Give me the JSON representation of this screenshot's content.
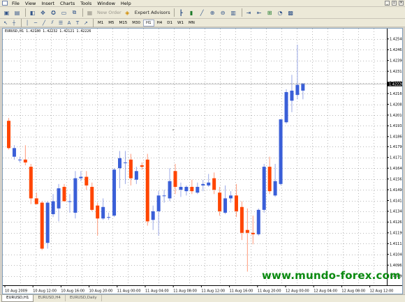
{
  "menu": [
    "File",
    "View",
    "Insert",
    "Charts",
    "Tools",
    "Window",
    "Help"
  ],
  "toolbar": {
    "new_order_label": "New Order",
    "expert_advisors_label": "Expert Advisors",
    "timeframes": [
      "M1",
      "M5",
      "M15",
      "M30",
      "H1",
      "H4",
      "D1",
      "W1",
      "MN"
    ],
    "active_timeframe": "H1"
  },
  "chart": {
    "title": "EURUSD,H1  1.42180 1.42232 1.42121 1.42226",
    "current_price": "1.42226",
    "bull_color": "#3a5fd8",
    "bear_color": "#ff4500",
    "watermark": "www.mundo-forex.com"
  },
  "chart_data": {
    "type": "candlestick",
    "title": "EURUSD,H1  1.42180 1.42232 1.42121 1.42226",
    "symbol": "EURUSD",
    "timeframe": "H1",
    "ohlc": [
      1.4218,
      1.42232,
      1.42121,
      1.42226
    ],
    "ylim": [
      1.40825,
      1.42612
    ],
    "y_ticks": [
      "1.42540",
      "1.42465",
      "1.42390",
      "1.42315",
      "1.42235",
      "1.42160",
      "1.42085",
      "1.42010",
      "1.41935",
      "1.41860",
      "1.41790",
      "1.41715",
      "1.41640",
      "1.41565",
      "1.41490",
      "1.41415",
      "1.41340",
      "1.41265",
      "1.41190",
      "1.41115",
      "1.41040",
      "1.40965",
      "1.40890"
    ],
    "x_ticks": [
      "10 Aug 2009",
      "10 Aug 12:00",
      "10 Aug 16:00",
      "10 Aug 20:00",
      "11 Aug 00:00",
      "11 Aug 04:00",
      "11 Aug 08:00",
      "11 Aug 12:00",
      "11 Aug 16:00",
      "11 Aug 20:00",
      "12 Aug 00:00",
      "12 Aug 04:00",
      "12 Aug 08:00",
      "12 Aug 12:00"
    ],
    "candles": [
      {
        "o": 1.4197,
        "h": 1.4199,
        "l": 1.4177,
        "c": 1.4178
      },
      {
        "o": 1.4172,
        "h": 1.418,
        "l": 1.417,
        "c": 1.4178
      },
      {
        "o": 1.417,
        "h": 1.4172,
        "l": 1.4168,
        "c": 1.417
      },
      {
        "o": 1.417,
        "h": 1.418,
        "l": 1.4166,
        "c": 1.4168
      },
      {
        "o": 1.4165,
        "h": 1.4167,
        "l": 1.4139,
        "c": 1.4143
      },
      {
        "o": 1.4143,
        "h": 1.4147,
        "l": 1.4139,
        "c": 1.4139
      },
      {
        "o": 1.414,
        "h": 1.4141,
        "l": 1.4107,
        "c": 1.4108
      },
      {
        "o": 1.4112,
        "h": 1.4141,
        "l": 1.4108,
        "c": 1.414
      },
      {
        "o": 1.4132,
        "h": 1.4146,
        "l": 1.413,
        "c": 1.4141
      },
      {
        "o": 1.4136,
        "h": 1.4153,
        "l": 1.4127,
        "c": 1.415
      },
      {
        "o": 1.4151,
        "h": 1.4153,
        "l": 1.4141,
        "c": 1.4141
      },
      {
        "o": 1.4141,
        "h": 1.4146,
        "l": 1.4133,
        "c": 1.4141
      },
      {
        "o": 1.4133,
        "h": 1.4162,
        "l": 1.4129,
        "c": 1.4157
      },
      {
        "o": 1.4157,
        "h": 1.4162,
        "l": 1.4155,
        "c": 1.4158
      },
      {
        "o": 1.4158,
        "h": 1.4162,
        "l": 1.4149,
        "c": 1.4152
      },
      {
        "o": 1.4151,
        "h": 1.4154,
        "l": 1.4134,
        "c": 1.4135
      },
      {
        "o": 1.4138,
        "h": 1.414,
        "l": 1.4117,
        "c": 1.4129
      },
      {
        "o": 1.4129,
        "h": 1.4143,
        "l": 1.4128,
        "c": 1.4137
      },
      {
        "o": 1.413,
        "h": 1.4133,
        "l": 1.4128,
        "c": 1.413
      },
      {
        "o": 1.4131,
        "h": 1.4164,
        "l": 1.413,
        "c": 1.4163
      },
      {
        "o": 1.4164,
        "h": 1.4176,
        "l": 1.415,
        "c": 1.4171
      },
      {
        "o": 1.4168,
        "h": 1.4176,
        "l": 1.4153,
        "c": 1.4168
      },
      {
        "o": 1.417,
        "h": 1.4174,
        "l": 1.4152,
        "c": 1.4157
      },
      {
        "o": 1.4156,
        "h": 1.4165,
        "l": 1.4153,
        "c": 1.4162
      },
      {
        "o": 1.4166,
        "h": 1.4168,
        "l": 1.4163,
        "c": 1.4165
      },
      {
        "o": 1.417,
        "h": 1.4174,
        "l": 1.4124,
        "c": 1.4127
      },
      {
        "o": 1.4128,
        "h": 1.4138,
        "l": 1.4121,
        "c": 1.4134
      },
      {
        "o": 1.4134,
        "h": 1.4148,
        "l": 1.4117,
        "c": 1.4145
      },
      {
        "o": 1.4145,
        "h": 1.4149,
        "l": 1.414,
        "c": 1.4145
      },
      {
        "o": 1.4143,
        "h": 1.4164,
        "l": 1.4141,
        "c": 1.4155
      },
      {
        "o": 1.4162,
        "h": 1.4167,
        "l": 1.4146,
        "c": 1.4151
      },
      {
        "o": 1.4149,
        "h": 1.4154,
        "l": 1.4144,
        "c": 1.4151
      },
      {
        "o": 1.4148,
        "h": 1.4152,
        "l": 1.4145,
        "c": 1.4151
      },
      {
        "o": 1.4151,
        "h": 1.4156,
        "l": 1.4146,
        "c": 1.4148
      },
      {
        "o": 1.4147,
        "h": 1.4154,
        "l": 1.4146,
        "c": 1.4151
      },
      {
        "o": 1.4152,
        "h": 1.4156,
        "l": 1.4148,
        "c": 1.4153
      },
      {
        "o": 1.4152,
        "h": 1.416,
        "l": 1.4151,
        "c": 1.4154
      },
      {
        "o": 1.4157,
        "h": 1.4161,
        "l": 1.4146,
        "c": 1.4149
      },
      {
        "o": 1.4147,
        "h": 1.4151,
        "l": 1.4131,
        "c": 1.4134
      },
      {
        "o": 1.4133,
        "h": 1.4152,
        "l": 1.4132,
        "c": 1.4143
      },
      {
        "o": 1.4143,
        "h": 1.4148,
        "l": 1.414,
        "c": 1.4145
      },
      {
        "o": 1.4145,
        "h": 1.4153,
        "l": 1.413,
        "c": 1.4134
      },
      {
        "o": 1.4137,
        "h": 1.4141,
        "l": 1.4114,
        "c": 1.4119
      },
      {
        "o": 1.4121,
        "h": 1.4136,
        "l": 1.4092,
        "c": 1.4119
      },
      {
        "o": 1.4119,
        "h": 1.4131,
        "l": 1.4111,
        "c": 1.4118
      },
      {
        "o": 1.4118,
        "h": 1.4136,
        "l": 1.4117,
        "c": 1.4135
      },
      {
        "o": 1.4135,
        "h": 1.4167,
        "l": 1.4133,
        "c": 1.4165
      },
      {
        "o": 1.4165,
        "h": 1.4172,
        "l": 1.4146,
        "c": 1.4148
      },
      {
        "o": 1.4145,
        "h": 1.4167,
        "l": 1.4144,
        "c": 1.4155
      },
      {
        "o": 1.4153,
        "h": 1.4198,
        "l": 1.4152,
        "c": 1.4198
      },
      {
        "o": 1.4196,
        "h": 1.4219,
        "l": 1.4195,
        "c": 1.4217
      },
      {
        "o": 1.4211,
        "h": 1.4229,
        "l": 1.4203,
        "c": 1.4218
      },
      {
        "o": 1.4215,
        "h": 1.425,
        "l": 1.4212,
        "c": 1.4222
      },
      {
        "o": 1.4218,
        "h": 1.4223,
        "l": 1.4212,
        "c": 1.4223
      }
    ]
  },
  "tabs": [
    "EURUSD,H1",
    "EURUSD,H4",
    "EURUSD,Daily"
  ],
  "active_tab": "EURUSD,H1"
}
